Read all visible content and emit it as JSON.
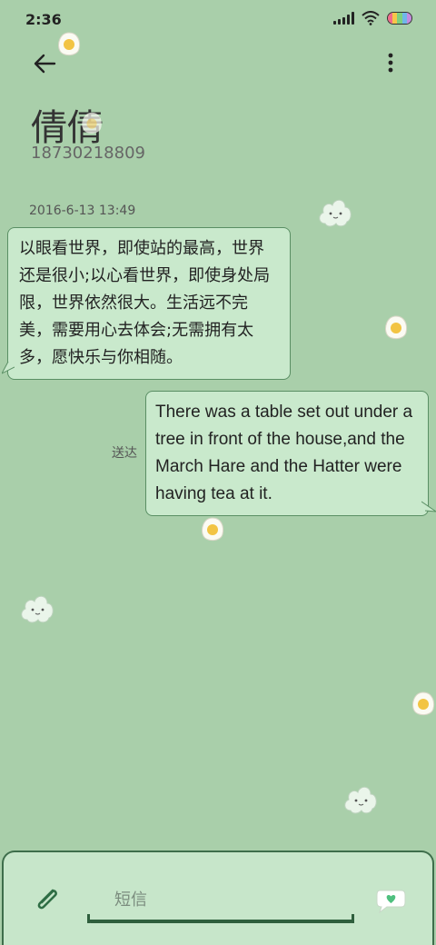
{
  "status_bar": {
    "time": "2:36"
  },
  "header": {
    "contact_name": "倩倩",
    "contact_number": "18730218809"
  },
  "conversation": {
    "timestamp": "2016-6-13 13:49",
    "incoming_message": "以眼看世界，即使站的最高，世界还是很小;以心看世界，即使身处局限，世界依然很大。生活远不完美，需要用心去体会;无需拥有太多，愿快乐与你相随。",
    "outgoing_message": "There was a table set out under a tree in front of the house,and the March Hare and the Hatter were having tea at it.",
    "outgoing_status": "送达"
  },
  "composer": {
    "placeholder": "短信"
  },
  "colors": {
    "background": "#a9cfaa",
    "bubble": "#c9e9cc",
    "bubble_border": "#5a8f64",
    "accent": "#2f5f3d"
  }
}
